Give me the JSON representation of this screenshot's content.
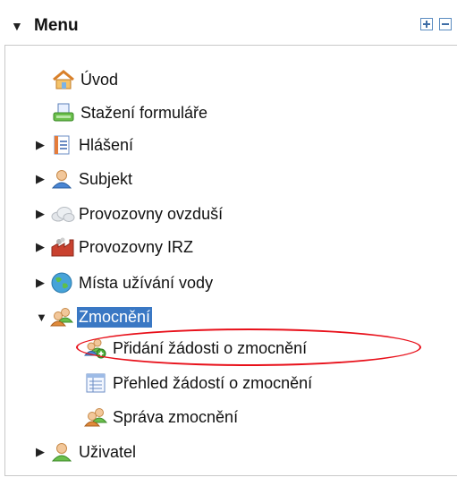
{
  "header": {
    "title": "Menu",
    "toggle_symbol": "▼",
    "expand_all_icon": "plus-box-icon",
    "collapse_all_icon": "minus-box-icon"
  },
  "tree": {
    "items": [
      {
        "label": "Úvod",
        "icon": "home-icon"
      },
      {
        "label": "Stažení formuláře",
        "icon": "download-form-icon"
      },
      {
        "label": "Hlášení",
        "icon": "report-icon",
        "arrow": "▶"
      },
      {
        "label": "Subjekt",
        "icon": "person-icon",
        "arrow": "▶"
      },
      {
        "label": "Provozovny ovzduší",
        "icon": "cloud-icon",
        "arrow": "▶"
      },
      {
        "label": "Provozovny IRZ",
        "icon": "factory-icon",
        "arrow": "▶"
      },
      {
        "label": "Místa užívání vody",
        "icon": "globe-icon",
        "arrow": "▶"
      },
      {
        "label": "Zmocnění",
        "icon": "people-icon",
        "arrow": "▼",
        "selected": true,
        "children": [
          {
            "label": "Přidání žádosti o zmocnění",
            "icon": "people-add-icon",
            "highlighted": true
          },
          {
            "label": "Přehled žádostí o zmocnění",
            "icon": "list-icon"
          },
          {
            "label": "Správa zmocnění",
            "icon": "people-icon"
          }
        ]
      },
      {
        "label": "Uživatel",
        "icon": "user-icon",
        "arrow": "▶"
      }
    ]
  },
  "colors": {
    "selection": "#3a78c4",
    "highlight_ring": "#e8101a",
    "border": "#c8c8c8"
  }
}
